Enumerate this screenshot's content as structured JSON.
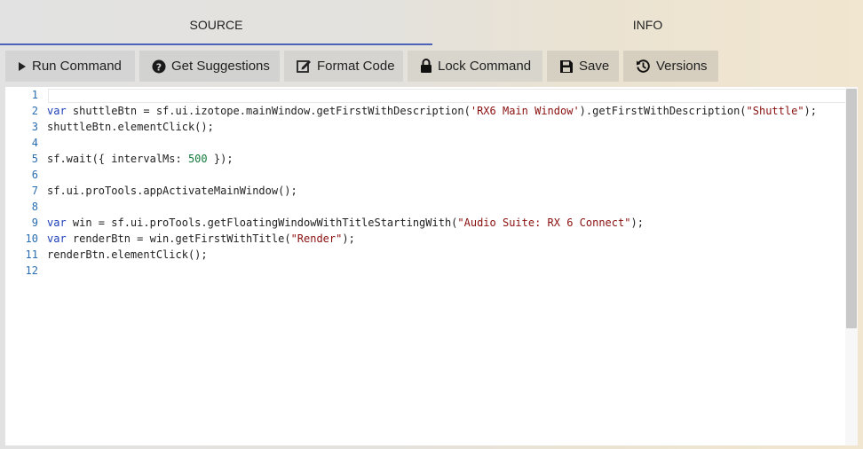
{
  "tabs": {
    "source": "SOURCE",
    "info": "INFO",
    "active": "SOURCE"
  },
  "toolbar": {
    "run_label": "Run Command",
    "suggestions_label": "Get Suggestions",
    "format_label": "Format Code",
    "lock_label": "Lock Command",
    "save_label": "Save",
    "versions_label": "Versions",
    "icons": {
      "run": "play-icon",
      "suggestions": "question-circle-icon",
      "format": "edit-icon",
      "lock": "lock-icon",
      "save": "floppy-disk-icon",
      "versions": "history-icon"
    }
  },
  "editor": {
    "line_numbers": [
      "1",
      "2",
      "3",
      "4",
      "5",
      "6",
      "7",
      "8",
      "9",
      "10",
      "11",
      "12"
    ],
    "lines": [
      [],
      [
        [
          "kw",
          "var"
        ],
        [
          "p",
          " shuttleBtn = sf.ui.izotope.mainWindow.getFirstWithDescription("
        ],
        [
          "str",
          "'RX6 Main Window'"
        ],
        [
          "p",
          ").getFirstWithDescription("
        ],
        [
          "str",
          "\"Shuttle\""
        ],
        [
          "p",
          ");"
        ]
      ],
      [
        [
          "p",
          "shuttleBtn.elementClick();"
        ]
      ],
      [],
      [
        [
          "p",
          "sf.wait({ intervalMs: "
        ],
        [
          "num",
          "500"
        ],
        [
          "p",
          " });"
        ]
      ],
      [],
      [
        [
          "p",
          "sf.ui.proTools.appActivateMainWindow();"
        ]
      ],
      [],
      [
        [
          "kw",
          "var"
        ],
        [
          "p",
          " win = sf.ui.proTools.getFloatingWindowWithTitleStartingWith("
        ],
        [
          "str",
          "\"Audio Suite: RX 6 Connect\""
        ],
        [
          "p",
          ");"
        ]
      ],
      [
        [
          "kw",
          "var"
        ],
        [
          "p",
          " renderBtn = win.getFirstWithTitle("
        ],
        [
          "str",
          "\"Render\""
        ],
        [
          "p",
          ");"
        ]
      ],
      [
        [
          "p",
          "renderBtn.elementClick();"
        ]
      ],
      []
    ]
  },
  "colors": {
    "keyword": "#1d3fb8",
    "string": "#8a1010",
    "number": "#137a3c",
    "line_number": "#2a6db0",
    "active_tab_underline": "#4a63b8"
  }
}
